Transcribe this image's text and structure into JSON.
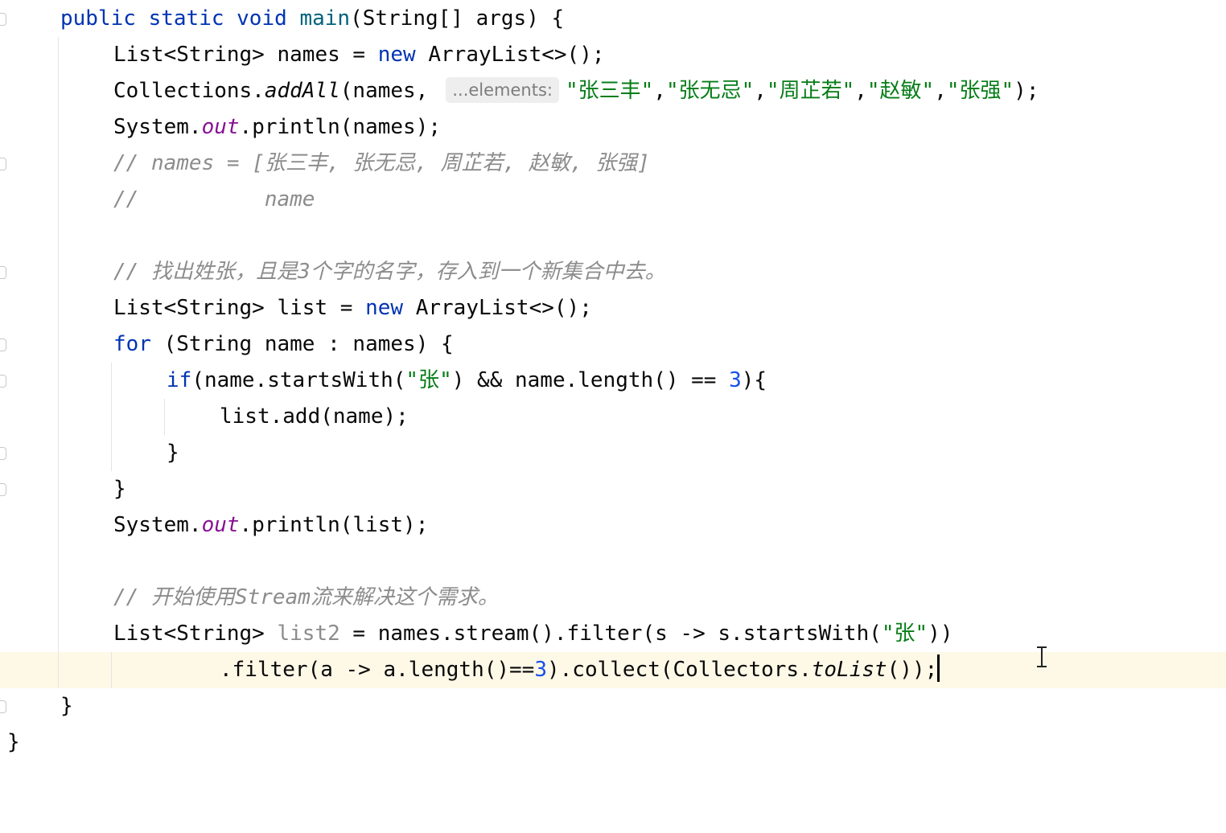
{
  "editor": {
    "lines": {
      "l01": {
        "t1": "public",
        "t2": "static",
        "t3": "void",
        "t4": "main",
        "t5": "(String[] args) {"
      },
      "l02": {
        "t1": "List<String> names = ",
        "t2": "new",
        "t3": " ArrayList<>();"
      },
      "l03": {
        "t1": "Collections.",
        "t2": "addAll",
        "t3": "(names,",
        "hint": "...elements:",
        "s1": "\"张三丰\"",
        "c1": ",",
        "s2": "\"张无忌\"",
        "c2": ",",
        "s3": "\"周芷若\"",
        "c3": ",",
        "s4": "\"赵敏\"",
        "c4": ",",
        "s5": "\"张强\"",
        "t4": ");"
      },
      "l04": {
        "t1": "System.",
        "t2": "out",
        "t3": ".println(names);"
      },
      "l05": {
        "t1": "// names = [张三丰, 张无忌, 周芷若, 赵敏, 张强]"
      },
      "l06": {
        "t1": "//          name"
      },
      "l08": {
        "t1": "// 找出姓张，且是3个字的名字，存入到一个新集合中去。"
      },
      "l09": {
        "t1": "List<String> list = ",
        "t2": "new",
        "t3": " ArrayList<>();"
      },
      "l10": {
        "t1": "for",
        "t2": " (String name : names) {"
      },
      "l11": {
        "t1": "if",
        "t2": "(name.startsWith(",
        "t3": "\"张\"",
        "t4": ") && name.length() == ",
        "t5": "3",
        "t6": "){"
      },
      "l12": {
        "t1": "list.add(name);"
      },
      "l13": {
        "t1": "}"
      },
      "l14": {
        "t1": "}"
      },
      "l15": {
        "t1": "System.",
        "t2": "out",
        "t3": ".println(list);"
      },
      "l17": {
        "t1": "// 开始使用Stream流来解决这个需求。"
      },
      "l18": {
        "t1": "List<String> ",
        "t2": "list2",
        "t3": " = names.stream().filter(s -> s.startsWith(",
        "t4": "\"张\"",
        "t5": "))"
      },
      "l19": {
        "t1": ".filter(a -> a.length()==",
        "t2": "3",
        "t3": ").collect(Collectors.",
        "t4": "toList",
        "t5": "());"
      },
      "l20": {
        "t1": "}"
      },
      "l21": {
        "t1": "}"
      }
    }
  },
  "colors": {
    "background": "#ffffff",
    "current_line": "#fef8e7",
    "keyword": "#0033b3",
    "method_decl": "#00627a",
    "string": "#067d17",
    "number": "#1750eb",
    "static_field": "#871094",
    "comment": "#8c8c8c",
    "inlay_hint_bg": "#eeeeee"
  },
  "icons": {
    "cursor": "i-beam-cursor-icon",
    "gutter": "fold-marker-icon"
  }
}
